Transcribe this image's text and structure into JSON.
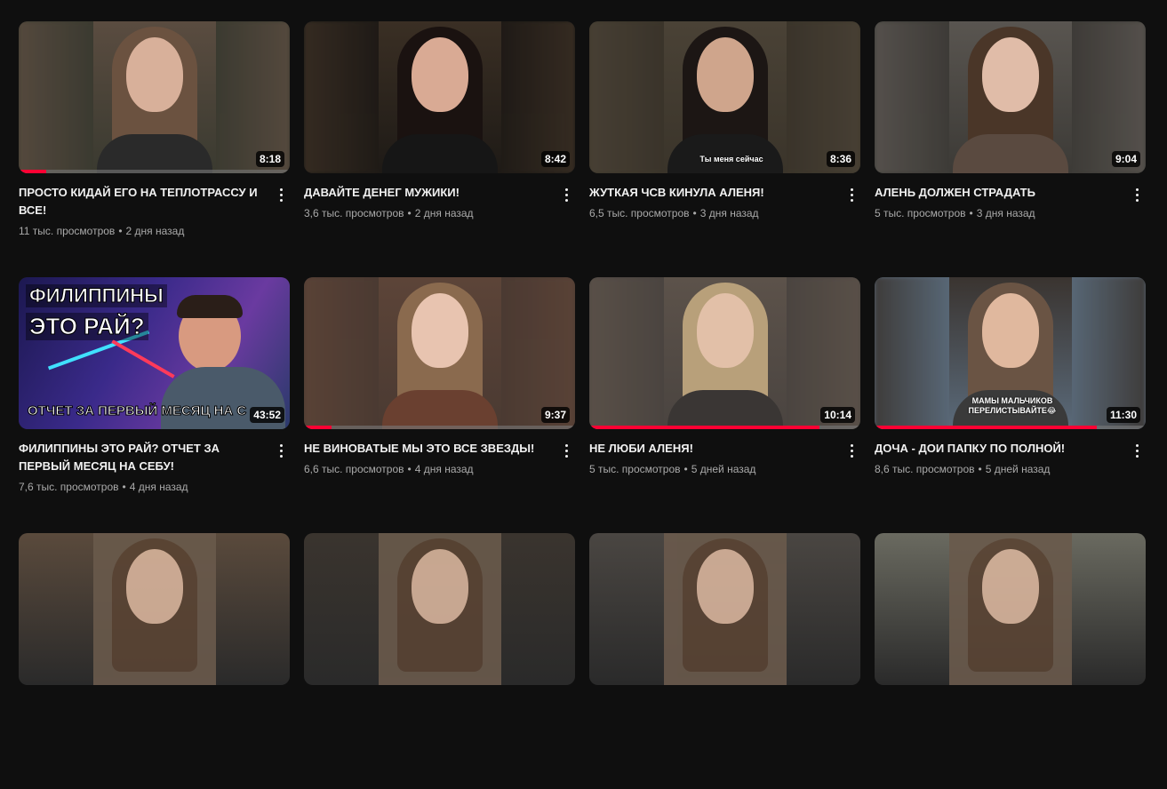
{
  "videos": [
    {
      "title": "ПРОСТО КИДАЙ ЕГО НА ТЕПЛОТРАССУ И ВСЕ!",
      "views": "11 тыс. просмотров",
      "age": "2 дня назад",
      "duration": "8:18",
      "progress": 0.1,
      "overlay": "",
      "colors": {
        "bg": "#3a3a30",
        "side": "#5a4c40",
        "hair": "#6b5240",
        "face": "#d8b09a",
        "body": "#2a2a2a"
      }
    },
    {
      "title": "ДАВАЙТЕ ДЕНЕГ МУЖИКИ!",
      "views": "3,6 тыс. просмотров",
      "age": "2 дня назад",
      "duration": "8:42",
      "progress": 0,
      "overlay": "",
      "colors": {
        "bg": "#1e1a16",
        "side": "#3a2f24",
        "hair": "#1a1210",
        "face": "#d9aa94",
        "body": "#161616"
      }
    },
    {
      "title": "ЖУТКАЯ ЧСВ КИНУЛА АЛЕНЯ!",
      "views": "6,5 тыс. просмотров",
      "age": "3 дня назад",
      "duration": "8:36",
      "progress": 0,
      "overlay": "Ты меня сейчас",
      "colors": {
        "bg": "#3a342a",
        "side": "#4a4236",
        "hair": "#1c1614",
        "face": "#cfa58c",
        "body": "#1a1a1a"
      }
    },
    {
      "title": "АЛЕНЬ ДОЛЖЕН СТРАДАТЬ",
      "views": "5 тыс. просмотров",
      "age": "3 дня назад",
      "duration": "9:04",
      "progress": 0,
      "overlay": "",
      "colors": {
        "bg": "#3c3a36",
        "side": "#595550",
        "hair": "#4a3628",
        "face": "#e0bca8",
        "body": "#5a4a40"
      }
    },
    {
      "title": "ФИЛИППИНЫ ЭТО РАЙ? ОТЧЕТ ЗА ПЕРВЫЙ МЕСЯЦ НА СЕБУ!",
      "views": "7,6 тыс. просмотров",
      "age": "4 дня назад",
      "duration": "43:52",
      "progress": 0,
      "overlay": "",
      "thumb_title_1": "ФИЛИППИНЫ",
      "thumb_title_2": "ЭТО РАЙ?",
      "thumb_bottom": "ОТЧЕТ ЗА ПЕРВЫЙ МЕСЯЦ НА С",
      "colors": {
        "bg": "#2a2460",
        "side": "#3a3080",
        "hair": "#2a1e18",
        "face": "#d89a80",
        "body": "#4a5a6a"
      }
    },
    {
      "title": "НЕ ВИНОВАТЫЕ МЫ ЭТО ВСЕ ЗВЕЗДЫ!",
      "views": "6,6 тыс. просмотров",
      "age": "4 дня назад",
      "duration": "9:37",
      "progress": 0.1,
      "overlay": "",
      "colors": {
        "bg": "#4a3a32",
        "side": "#5c4438",
        "hair": "#8a6a4e",
        "face": "#e8c4b0",
        "body": "#6a4030"
      }
    },
    {
      "title": "НЕ ЛЮБИ АЛЕНЯ!",
      "views": "5 тыс. просмотров",
      "age": "5 дней назад",
      "duration": "10:14",
      "progress": 0.85,
      "overlay": "",
      "colors": {
        "bg": "#4a4440",
        "side": "#5c524a",
        "hair": "#b8a07a",
        "face": "#e2c0a8",
        "body": "#3a3634"
      }
    },
    {
      "title": "ДОЧА - ДОИ ПАПКУ ПО ПОЛНОЙ!",
      "views": "8,6 тыс. просмотров",
      "age": "5 дней назад",
      "duration": "11:30",
      "progress": 0.82,
      "overlay": "МАМЫ МАЛЬЧИКОВ ПЕРЕЛИСТЫВАЙТЕ😂",
      "colors": {
        "bg": "#5a6a7a",
        "side": "#3a3430",
        "hair": "#6a5444",
        "face": "#e0b89e",
        "body": "#3a3a3a"
      }
    }
  ],
  "next_row_colors": [
    "#5a4a3c",
    "#3a342e",
    "#4a4642",
    "#6a6a60"
  ],
  "icons": {
    "menu": "more-vert-icon"
  }
}
